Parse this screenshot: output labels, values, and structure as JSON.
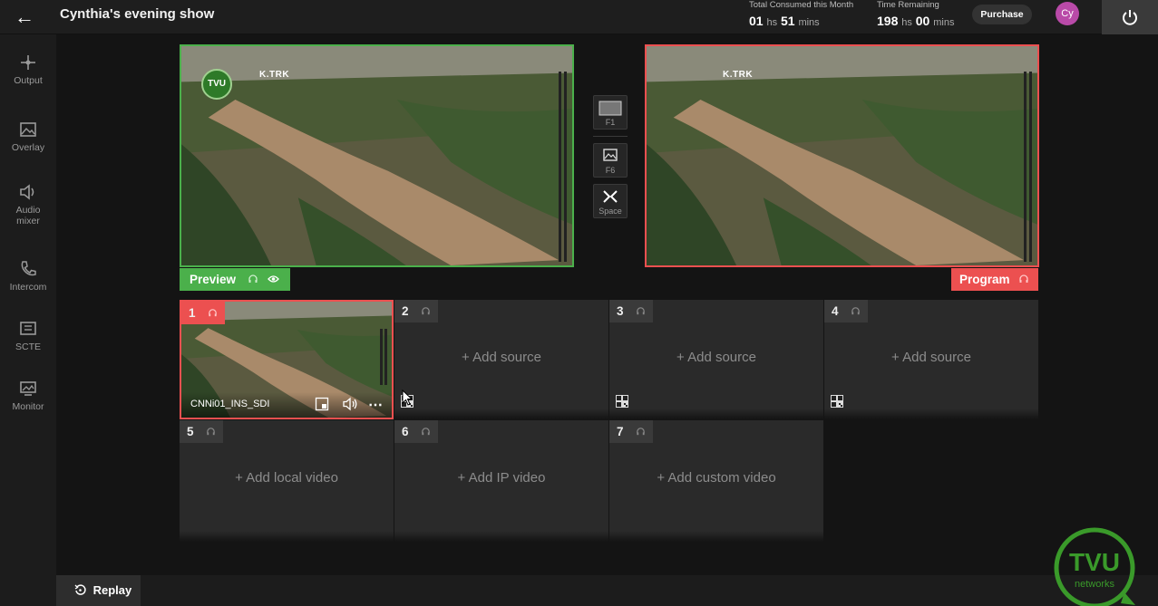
{
  "header": {
    "title": "Cynthia's evening show",
    "consumed_label": "Total Consumed this Month",
    "consumed_hours": "01",
    "consumed_mins": "51",
    "remaining_label": "Time Remaining",
    "remaining_hours": "198",
    "remaining_mins": "00",
    "hs_unit": "hs",
    "mins_unit": "mins",
    "purchase_label": "Purchase",
    "avatar_initials": "Cy"
  },
  "sidebar": {
    "items": [
      {
        "label": "Output",
        "icon": "output-icon"
      },
      {
        "label": "Overlay",
        "icon": "image-icon"
      },
      {
        "label": "Audio mixer",
        "icon": "speaker-icon"
      },
      {
        "label": "Intercom",
        "icon": "phone-icon"
      },
      {
        "label": "SCTE",
        "icon": "ad-icon"
      },
      {
        "label": "Monitor",
        "icon": "monitor-icon"
      }
    ]
  },
  "preview": {
    "label": "Preview",
    "watermark": "K.TRK",
    "logo_text": "TVU",
    "border_color": "#4bb04b"
  },
  "program": {
    "label": "Program",
    "watermark": "K.TRK",
    "border_color": "#ec5050"
  },
  "controls": [
    {
      "key": "F1",
      "icon": "cut-icon"
    },
    {
      "key": "F6",
      "icon": "image-icon"
    },
    {
      "key": "Space",
      "icon": "transition-icon"
    }
  ],
  "sources": [
    {
      "num": "1",
      "name": "CNNi01_INS_SDI",
      "add": ""
    },
    {
      "num": "2",
      "add": "+ Add source"
    },
    {
      "num": "3",
      "add": "+ Add source"
    },
    {
      "num": "4",
      "add": "+ Add source"
    },
    {
      "num": "5",
      "add": "+ Add local video"
    },
    {
      "num": "6",
      "add": "+ Add IP video"
    },
    {
      "num": "7",
      "add": "+ Add custom video"
    }
  ],
  "footer": {
    "replay_label": "Replay"
  },
  "brand": {
    "logo_text": "TVU",
    "logo_subtext": "networks",
    "accent": "#3a9a2a"
  }
}
